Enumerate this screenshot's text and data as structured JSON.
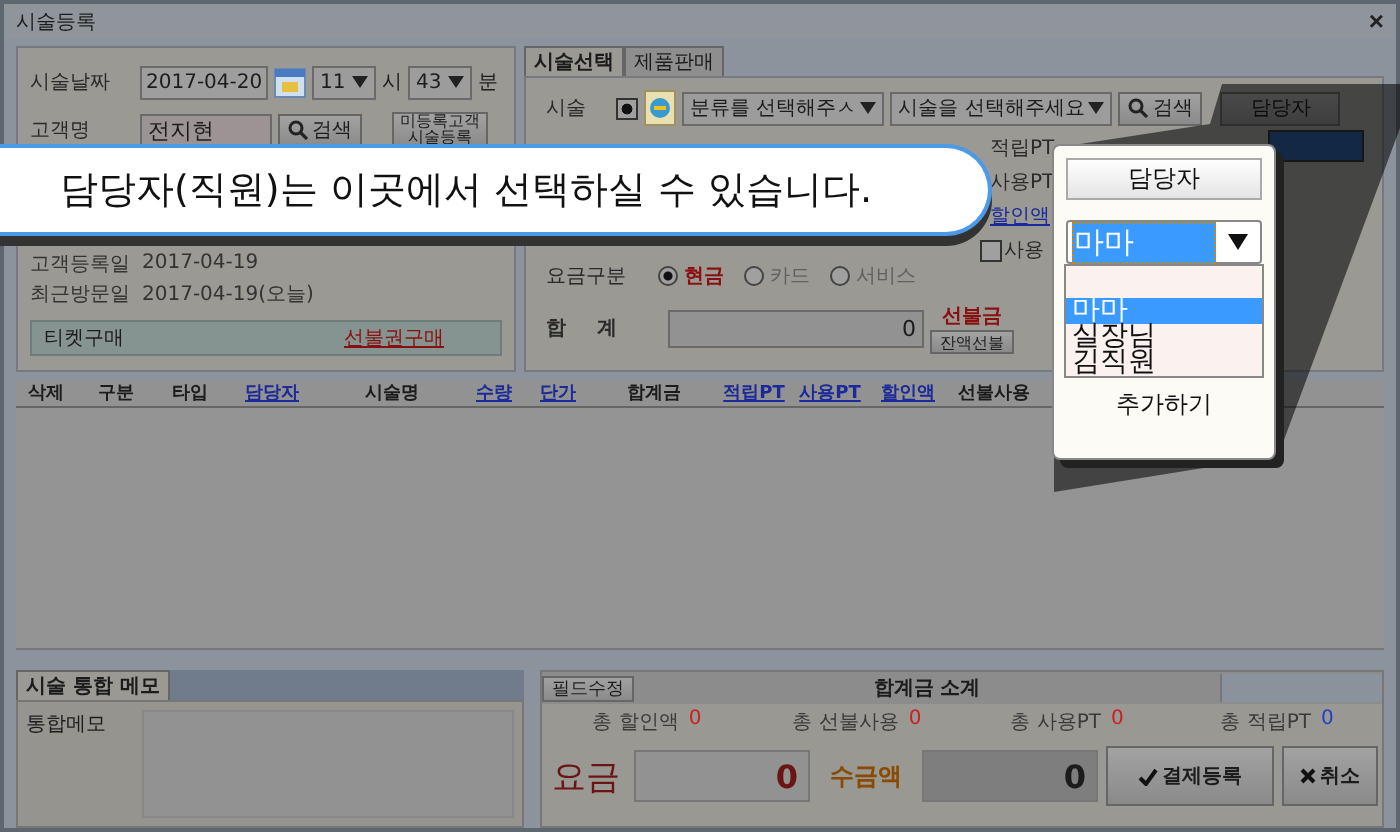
{
  "window": {
    "title": "시술등록",
    "close": "×"
  },
  "visit": {
    "date_label": "시술날짜",
    "date": "2017-04-20",
    "hour": "11",
    "hour_unit": "시",
    "minute": "43",
    "minute_unit": "분",
    "customer_label": "고객명",
    "customer": "전지현",
    "search_button": "검색",
    "unregistered_button": "미등록고객 시술등록"
  },
  "customer_info": [
    {
      "label": "고객등록일",
      "value": "2017-04-19"
    },
    {
      "label": "최근방문일",
      "value": "2017-04-19(오늘)"
    }
  ],
  "ticket": {
    "label": "티켓구매",
    "link": "선불권구매"
  },
  "tabs": [
    {
      "label": "시술선택",
      "selected": true
    },
    {
      "label": "제품판매",
      "selected": false
    }
  ],
  "service": {
    "label": "시술",
    "checked": true,
    "category_placeholder": "분류를 선택해주ㅅ",
    "service_placeholder": "시술을 선택해주세요",
    "search_button": "검색",
    "staff_button": "담당자",
    "earn_pt_label": "적립PT",
    "use_pt_label": "사용PT",
    "discount_link": "할인액",
    "use_label": "사용",
    "use_checked": false
  },
  "payment_type": {
    "label": "요금구분",
    "options": [
      {
        "label": "현금",
        "selected": true
      },
      {
        "label": "카드",
        "selected": false
      },
      {
        "label": "서비스",
        "selected": false
      }
    ]
  },
  "total": {
    "label": "합 계",
    "value": "0",
    "prepaid_label": "선불금",
    "prepaid_button": "잔액선불"
  },
  "table": {
    "columns": [
      {
        "label": "삭제",
        "link": false
      },
      {
        "label": "구분",
        "link": false
      },
      {
        "label": "타입",
        "link": false
      },
      {
        "label": "담당자",
        "link": true
      },
      {
        "label": "시술명",
        "link": false
      },
      {
        "label": "수량",
        "link": true
      },
      {
        "label": "단가",
        "link": true
      },
      {
        "label": "합계금",
        "link": false
      },
      {
        "label": "적립PT",
        "link": true
      },
      {
        "label": "사용PT",
        "link": true
      },
      {
        "label": "할인액",
        "link": true
      },
      {
        "label": "선불사용",
        "link": false
      }
    ]
  },
  "memo": {
    "tab": "시술 통합 메모",
    "label": "통합메모"
  },
  "summary": {
    "edit_button": "필드수정",
    "title": "합계금 소계",
    "totals": [
      {
        "label": "총 할인액",
        "value": "0",
        "color": "#cc2020"
      },
      {
        "label": "총 선불사용",
        "value": "0",
        "color": "#cc2020"
      },
      {
        "label": "총 사용PT",
        "value": "0",
        "color": "#cc2020"
      },
      {
        "label": "총 적립PT",
        "value": "0",
        "color": "#2040cc"
      }
    ],
    "fee_label": "요금",
    "fee": "0",
    "received_label": "수금액",
    "received": "0",
    "pay_button": "결제등록",
    "cancel_button": "취소"
  },
  "callout": {
    "text": "담당자(직원)는 이곳에서 선택하실 수 있습니다."
  },
  "popup": {
    "button": "담당자",
    "value": "마마",
    "options": [
      {
        "label": "마마",
        "selected": true
      },
      {
        "label": "실장님",
        "selected": false
      },
      {
        "label": "김직원",
        "selected": false
      }
    ],
    "add": "추가하기"
  }
}
